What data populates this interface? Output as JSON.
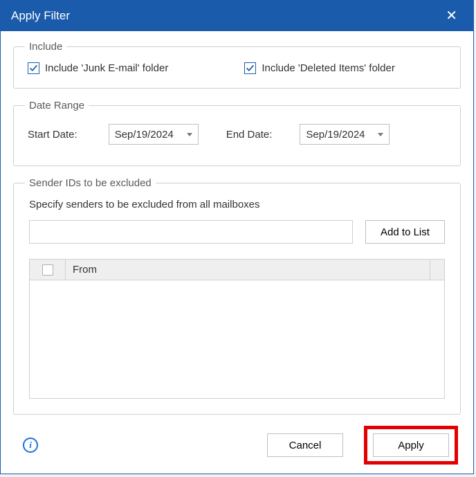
{
  "title": "Apply Filter",
  "include": {
    "legend": "Include",
    "junk": {
      "label": "Include 'Junk E-mail' folder",
      "checked": true
    },
    "deleted": {
      "label": "Include 'Deleted Items' folder",
      "checked": true
    }
  },
  "dateRange": {
    "legend": "Date Range",
    "start": {
      "label": "Start Date:",
      "value": "Sep/19/2024"
    },
    "end": {
      "label": "End Date:",
      "value": "Sep/19/2024"
    }
  },
  "senders": {
    "legend": "Sender IDs to be excluded",
    "caption": "Specify senders to be excluded from all mailboxes",
    "input": "",
    "addLabel": "Add to List",
    "grid": {
      "fromHeader": "From",
      "rows": []
    }
  },
  "footer": {
    "cancel": "Cancel",
    "apply": "Apply"
  }
}
